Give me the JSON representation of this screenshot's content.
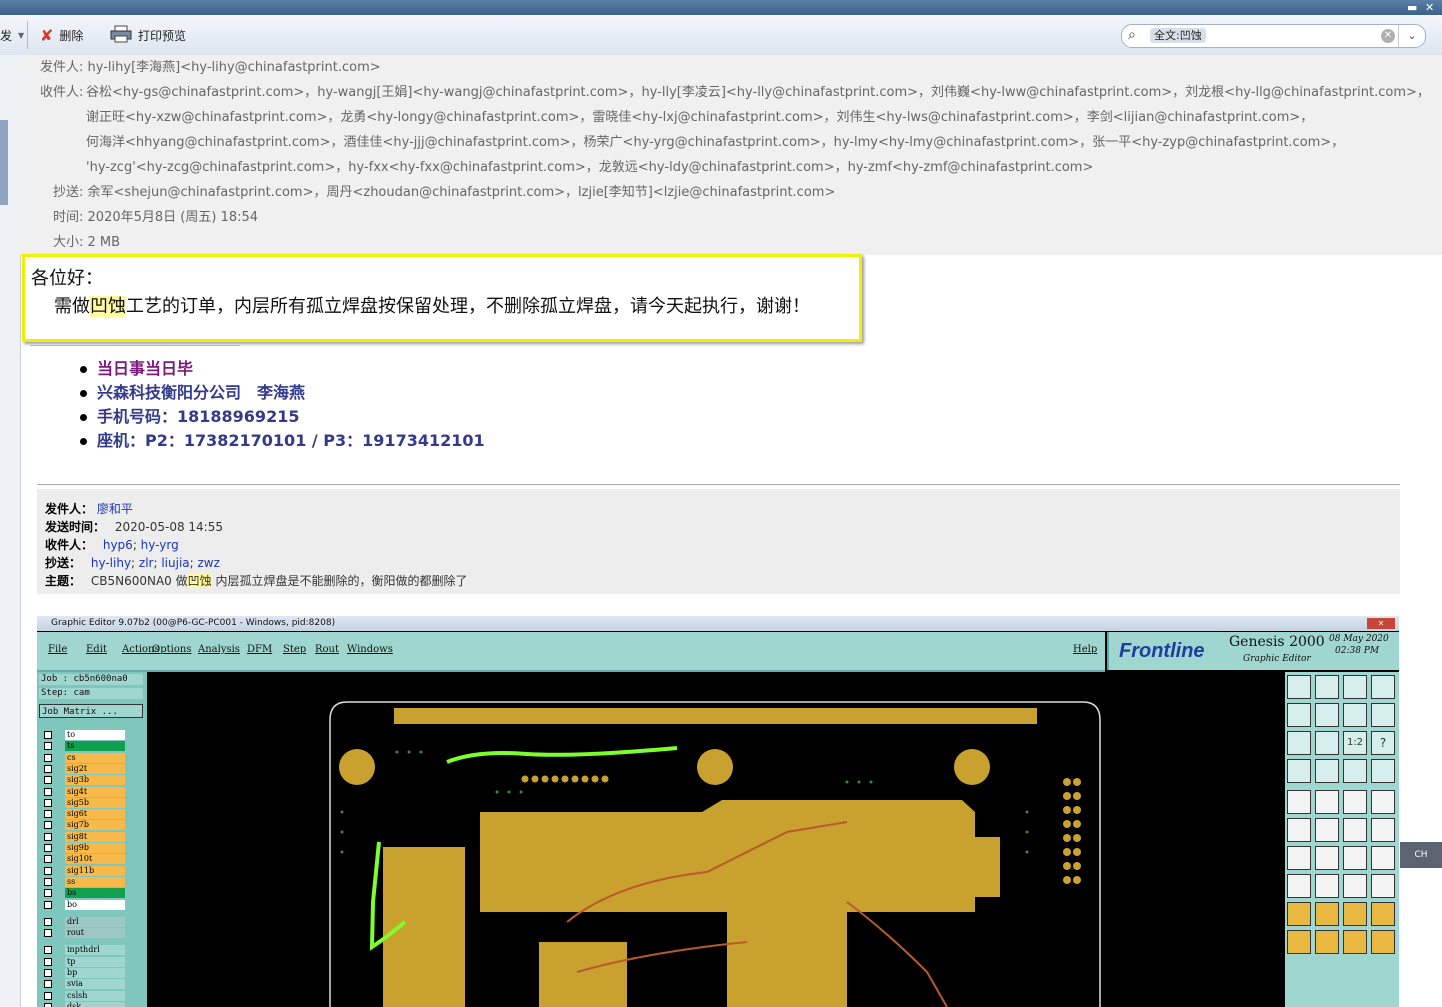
{
  "toolbar": {
    "cut_left_label": "发",
    "delete_label": "删除",
    "print_preview_label": "打印预览",
    "search_chip": "全文:凹蚀"
  },
  "header": {
    "from_label": "发件人:",
    "from_value": "hy-lihy[李海燕]<hy-lihy@chinafastprint.com>",
    "to_label": "收件人:",
    "to_lines": [
      "谷松<hy-gs@chinafastprint.com>，hy-wangj[王娟]<hy-wangj@chinafastprint.com>，hy-lly[李凌云]<hy-lly@chinafastprint.com>，刘伟巍<hy-lww@chinafastprint.com>，刘龙根<hy-llg@chinafastprint.com>，",
      "谢正旺<hy-xzw@chinafastprint.com>，龙勇<hy-longy@chinafastprint.com>，雷晓佳<hy-lxj@chinafastprint.com>，刘伟生<hy-lws@chinafastprint.com>，李剑<lijian@chinafastprint.com>，",
      "何海洋<hhyang@chinafastprint.com>，酒佳佳<hy-jjj@chinafastprint.com>，杨荣广<hy-yrg@chinafastprint.com>，hy-lmy<hy-lmy@chinafastprint.com>，张一平<hy-zyp@chinafastprint.com>，",
      "'hy-zcg'<hy-zcg@chinafastprint.com>，hy-fxx<hy-fxx@chinafastprint.com>，龙敦远<hy-ldy@chinafastprint.com>，hy-zmf<hy-zmf@chinafastprint.com>"
    ],
    "cc_label": "抄送:",
    "cc_value": "余军<shejun@chinafastprint.com>，周丹<zhoudan@chinafastprint.com>，lzjie[李知节]<lzjie@chinafastprint.com>",
    "time_label": "时间:",
    "time_value": "2020年5月8日 (周五) 18:54",
    "size_label": "大小:",
    "size_value": "2 MB"
  },
  "body": {
    "greeting": "各位好：",
    "msg_before": "需做",
    "msg_highlight": "凹蚀",
    "msg_after": "工艺的订单，内层所有孤立焊盘按保留处理，不删除孤立焊盘，请今天起执行，谢谢！"
  },
  "signature": [
    "当日事当日毕",
    "兴森科技衡阳分公司　李海燕",
    "手机号码：18188969215",
    "座机：P2：17382170101 / P3：19173412101"
  ],
  "forwarded": {
    "from_label": "发件人：",
    "from_value": "廖和平",
    "sent_label": "发送时间：",
    "sent_value": "2020-05-08 14:55",
    "to_label": "收件人：",
    "to_values": [
      "hyp6",
      "hy-yrg"
    ],
    "cc_label": "抄送：",
    "cc_values": [
      "hy-lihy",
      "zlr",
      "liujia",
      "zwz"
    ],
    "subject_label": "主题：",
    "subject_before": "CB5N600NA0 做",
    "subject_highlight": "凹蚀",
    "subject_after": " 内层孤立焊盘是不能删除的，衡阳做的都删除了"
  },
  "app": {
    "window_title": "Graphic Editor 9.07b2 (00@P6-GC-PC001 - Windows, pid:8208)",
    "menus": [
      "File",
      "Edit",
      "Actions",
      "Options",
      "Analysis",
      "DFM",
      "Step",
      "Rout",
      "Windows"
    ],
    "help": "Help",
    "brand": "Frontline",
    "product": "Genesis 2000",
    "product_sub": "Graphic Editor",
    "date": "08 May 2020",
    "clock": "02:38 PM",
    "job": "Job  : cb5n600na0",
    "step": "Step: cam",
    "job_matrix": "Job Matrix ...",
    "layers": [
      {
        "name": "to",
        "color": "#ffffff"
      },
      {
        "name": "ts",
        "color": "#10a050"
      },
      {
        "name": "cs",
        "color": "#f6b94a"
      },
      {
        "name": "sig2t",
        "color": "#f6b94a"
      },
      {
        "name": "sig3b",
        "color": "#f6b94a"
      },
      {
        "name": "sig4t",
        "color": "#f6b94a"
      },
      {
        "name": "sig5b",
        "color": "#f6b94a"
      },
      {
        "name": "sig6t",
        "color": "#f6b94a"
      },
      {
        "name": "sig7b",
        "color": "#f6b94a"
      },
      {
        "name": "sig8t",
        "color": "#f6b94a"
      },
      {
        "name": "sig9b",
        "color": "#f6b94a"
      },
      {
        "name": "sig10t",
        "color": "#f6b94a"
      },
      {
        "name": "sig11b",
        "color": "#f6b94a"
      },
      {
        "name": "ss",
        "color": "#f6b94a"
      },
      {
        "name": "bs",
        "color": "#10a050"
      },
      {
        "name": "bo",
        "color": "#ffffff"
      },
      {
        "name": "drl",
        "color": "#9fc7c2"
      },
      {
        "name": "rout",
        "color": "#9fc7c2"
      },
      {
        "name": "inpthdrl",
        "color": "#9fd6cf"
      },
      {
        "name": "tp",
        "color": "#9fd6cf"
      },
      {
        "name": "bp",
        "color": "#9fd6cf"
      },
      {
        "name": "svia",
        "color": "#9fd6cf"
      },
      {
        "name": "cslsh",
        "color": "#9fd6cf"
      },
      {
        "name": "dsk",
        "color": "#9fd6cf"
      }
    ],
    "ratio_label": "1:2",
    "ch_tab": "CH"
  }
}
